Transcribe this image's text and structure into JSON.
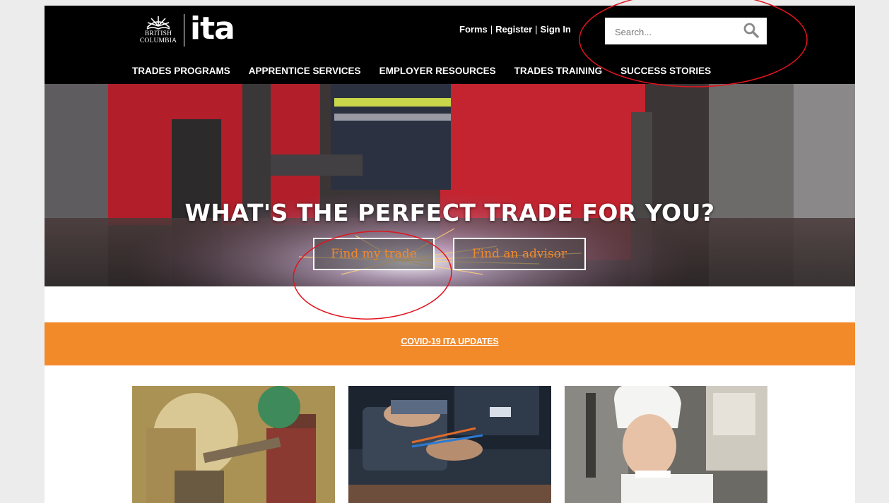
{
  "brand": {
    "bc_line1": "BRITISH",
    "bc_line2": "COLUMBIA",
    "wordmark": "ita"
  },
  "utility_links": {
    "forms": "Forms",
    "register": "Register",
    "signin": "Sign In",
    "separator": "|"
  },
  "search": {
    "placeholder": "Search..."
  },
  "nav": [
    "TRADES PROGRAMS",
    "APPRENTICE SERVICES",
    "EMPLOYER RESOURCES",
    "TRADES TRAINING",
    "SUCCESS STORIES"
  ],
  "hero": {
    "title": "WHAT'S THE PERFECT TRADE FOR YOU?",
    "button_find_trade": "Find my trade",
    "button_find_advisor": "Find an advisor"
  },
  "alert_banner": {
    "link_text": "COVID-19 ITA UPDATES"
  },
  "cards": [
    {
      "image": "welder-in-protective-gear"
    },
    {
      "image": "mechanic-hands-wiring"
    },
    {
      "image": "young-chef-in-white-hat"
    }
  ],
  "colors": {
    "accent_orange": "#f28a2a",
    "header_black": "#000000",
    "annotation_red": "#e0141e",
    "page_gutter": "#ececec"
  }
}
